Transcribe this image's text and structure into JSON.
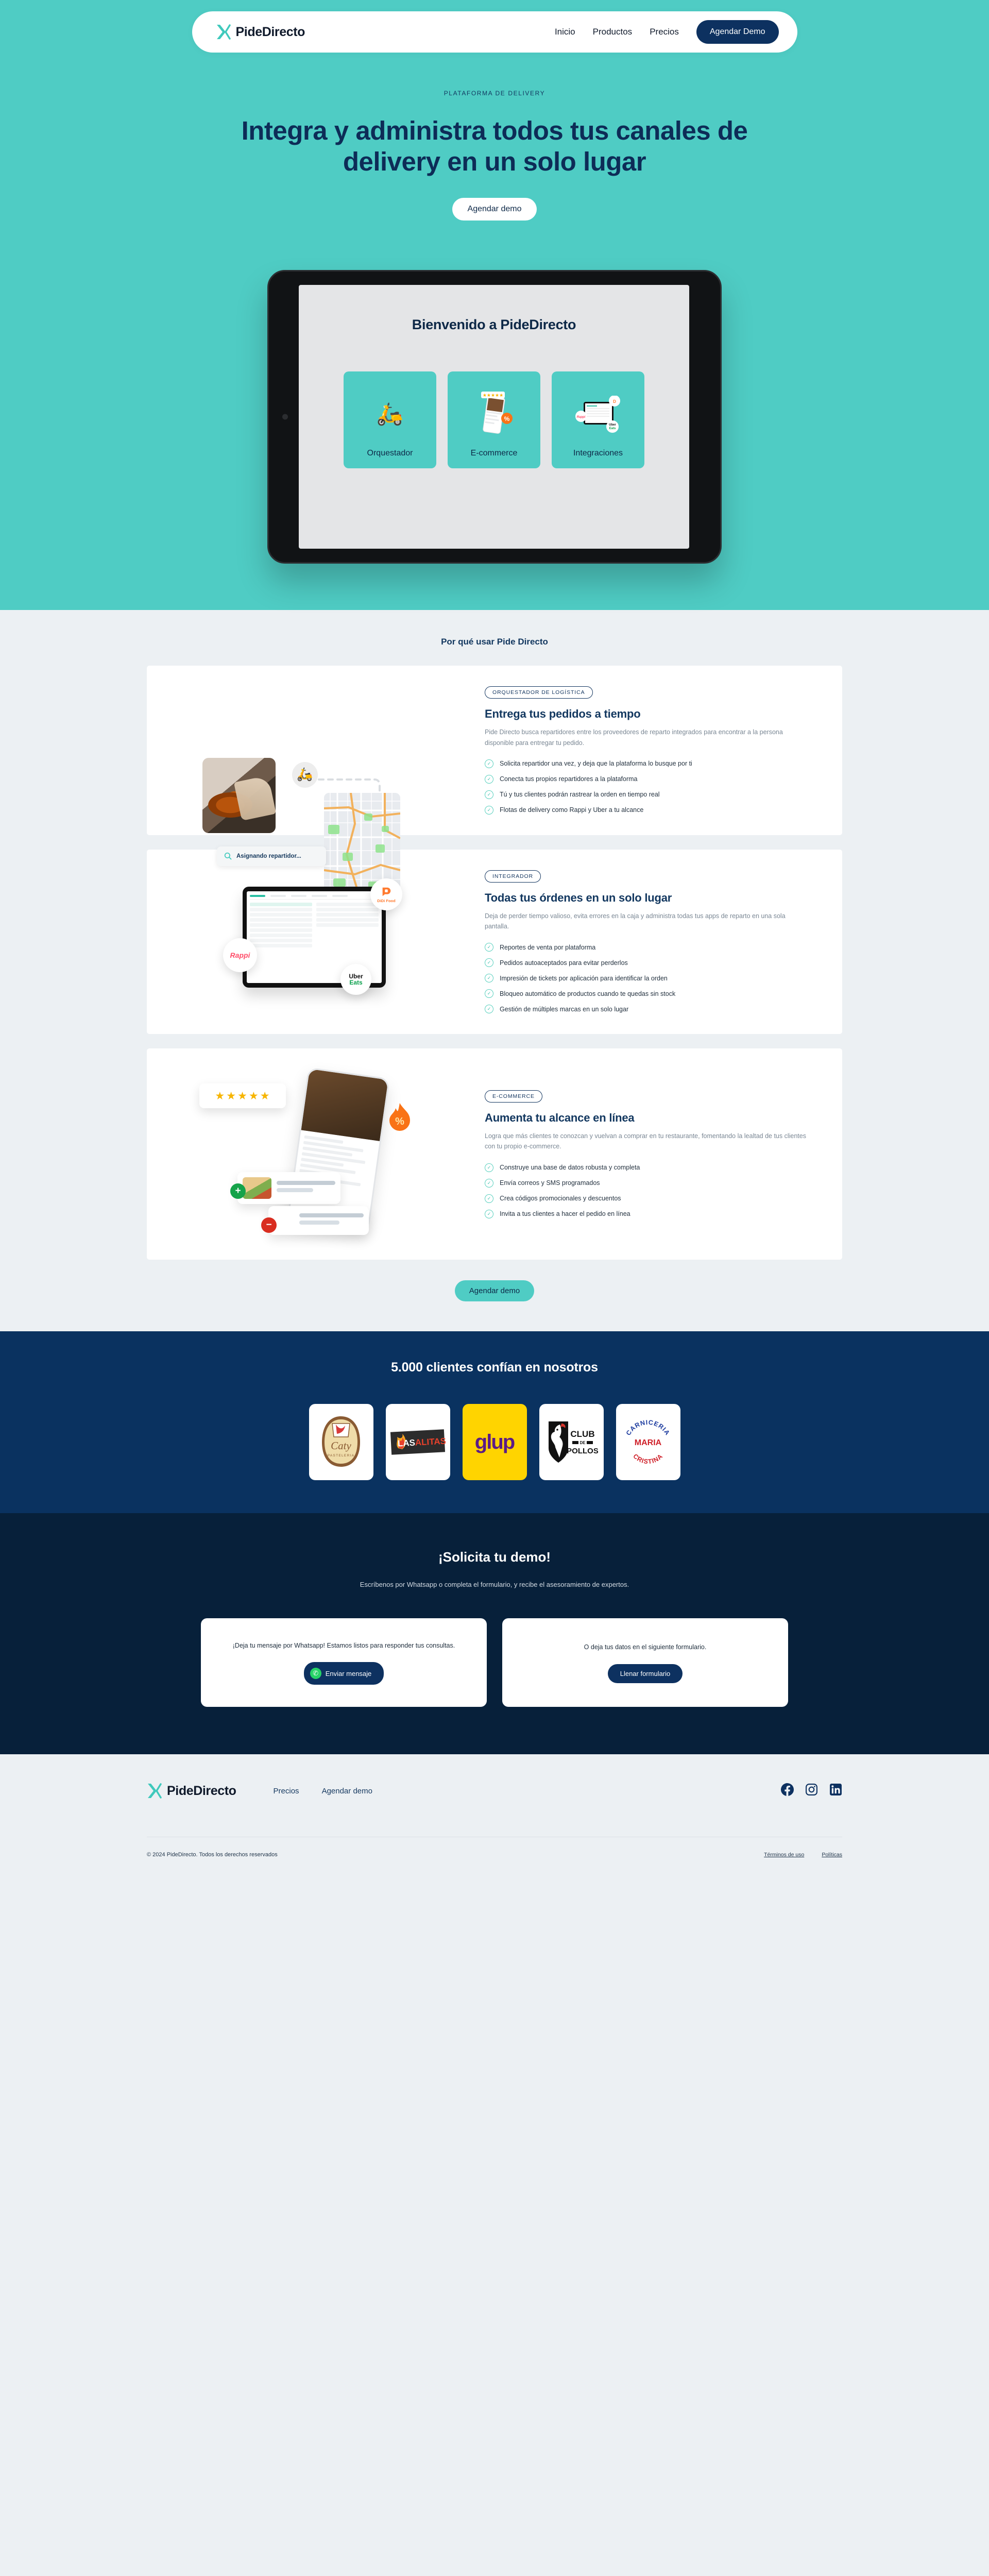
{
  "nav": {
    "brand": "PideDirecto",
    "links": [
      {
        "label": "Inicio"
      },
      {
        "label": "Productos"
      },
      {
        "label": "Precios"
      }
    ],
    "cta": "Agendar Demo"
  },
  "hero": {
    "eyebrow": "PLATAFORMA DE DELIVERY",
    "title": "Integra y administra todos tus canales de delivery en un solo lugar",
    "cta": "Agendar demo",
    "tablet": {
      "title": "Bienvenido a PideDirecto",
      "tiles": [
        {
          "label": "Orquestador",
          "icon": "scooter-icon"
        },
        {
          "label": "E-commerce",
          "icon": "phone-stars-icon"
        },
        {
          "label": "Integraciones",
          "icon": "tablet-logos-icon"
        }
      ]
    }
  },
  "why": {
    "title": "Por qué usar Pide Directo",
    "cta": "Agendar demo",
    "cards": [
      {
        "pill": "ORQUESTADOR DE LOGÍSTICA",
        "heading": "Entrega tus pedidos a tiempo",
        "paragraph": "Pide Directo busca repartidores entre los proveedores de reparto integrados para encontrar a la persona disponible para entregar tu pedido.",
        "items": [
          "Solicita repartidor una vez, y deja que la plataforma lo busque por ti",
          "Conecta tus propios repartidores a la plataforma",
          "Tú y tus clientes podrán rastrear la orden en tiempo real",
          "Flotas de delivery como Rappi y Uber a tu alcance"
        ],
        "art_label": "Asignando repartidor..."
      },
      {
        "pill": "INTEGRADOR",
        "heading": "Todas tus órdenes en un solo lugar",
        "paragraph": "Deja de perder tiempo valioso, evita errores en la caja y administra todas tus apps de reparto en una sola pantalla.",
        "items": [
          "Reportes de venta por plataforma",
          "Pedidos autoaceptados para evitar perderlos",
          "Impresión de tickets por aplicación para identificar la orden",
          "Bloqueo automático de productos cuando te quedas sin stock",
          "Gestión de múltiples marcas en un solo lugar"
        ],
        "badges": [
          "DiDi Food",
          "Rappi",
          "Uber Eats"
        ]
      },
      {
        "pill": "E-COMMERCE",
        "heading": "Aumenta tu alcance en línea",
        "paragraph": "Logra que más clientes te conozcan y vuelvan a comprar en tu restaurante, fomentando la lealtad de tus clientes con tu propio e-commerce.",
        "items": [
          "Construye una base de datos robusta y completa",
          "Envía correos y SMS programados",
          "Crea códigos promocionales y descuentos",
          "Invita a tus clientes a hacer el pedido en línea"
        ]
      }
    ]
  },
  "clients": {
    "title": "5.000 clientes confían en nosotros",
    "logos": [
      {
        "name": "Caty Pastelería",
        "line1": "Caty",
        "line2": "PASTELERIA"
      },
      {
        "name": "Las Alitas",
        "line1": "LAS",
        "line2": "ALITAS"
      },
      {
        "name": "glup",
        "line1": "glup",
        "line2": ""
      },
      {
        "name": "Club de Pollos",
        "line1": "CLUB",
        "line2": "DE POLLOS"
      },
      {
        "name": "Carnicería María Cristina",
        "line1": "CARNICERIA",
        "line2": "MARIA CRISTINA"
      }
    ]
  },
  "demo": {
    "title": "¡Solicita tu demo!",
    "subtitle": "Escríbenos por Whatsapp o completa el formulario, y recibe el asesoramiento de expertos.",
    "cards": [
      {
        "text": "¡Deja tu mensaje por Whatsapp! Estamos listos para responder tus consultas.",
        "button": "Enviar mensaje",
        "icon": "whatsapp-icon"
      },
      {
        "text": "O deja tus datos en el siguiente formulario.",
        "button": "Llenar formulario",
        "icon": ""
      }
    ]
  },
  "footer": {
    "brand": "PideDirecto",
    "links": [
      {
        "label": "Precios"
      },
      {
        "label": "Agendar demo"
      }
    ],
    "socials": [
      {
        "name": "facebook-icon"
      },
      {
        "name": "instagram-icon"
      },
      {
        "name": "linkedin-icon"
      }
    ],
    "copyright": "© 2024 PideDirecto. Todos los derechos reservados",
    "legal": [
      {
        "label": "Términos de uso"
      },
      {
        "label": "Políticas"
      }
    ]
  },
  "colors": {
    "teal": "#4FCCC4",
    "navy": "#0D3160",
    "deep_navy": "#0A3260",
    "dark": "#07203A",
    "light_gray": "#ECF0F3"
  }
}
